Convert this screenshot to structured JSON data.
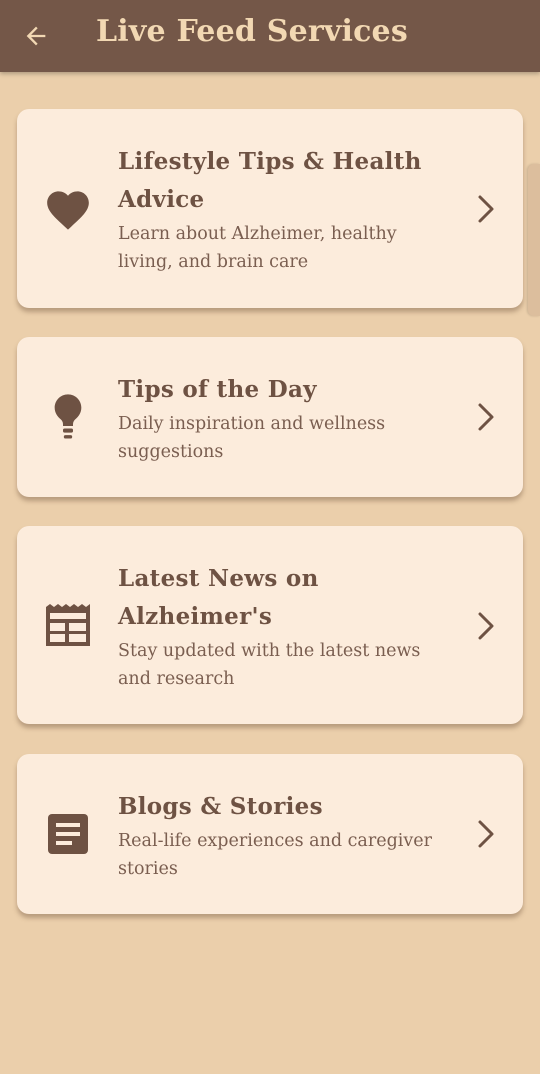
{
  "header": {
    "title": "Live Feed Services"
  },
  "cards": [
    {
      "title": "Lifestyle Tips & Health Advice",
      "subtitle": "Learn about Alzheimer, healthy living, and brain care",
      "icon": "heart-icon"
    },
    {
      "title": "Tips of the Day",
      "subtitle": "Daily inspiration and wellness suggestions",
      "icon": "lightbulb-icon"
    },
    {
      "title": "Latest News on Alzheimer's",
      "subtitle": "Stay updated with the latest news and research",
      "icon": "newspaper-icon"
    },
    {
      "title": "Blogs & Stories",
      "subtitle": "Real-life experiences and caregiver stories",
      "icon": "article-icon"
    }
  ],
  "colors": {
    "background": "#ebcfab",
    "app_bar": "#745748",
    "title_text": "#f2d8b3",
    "card": "#fcecdc",
    "accent": "#6e5243"
  }
}
